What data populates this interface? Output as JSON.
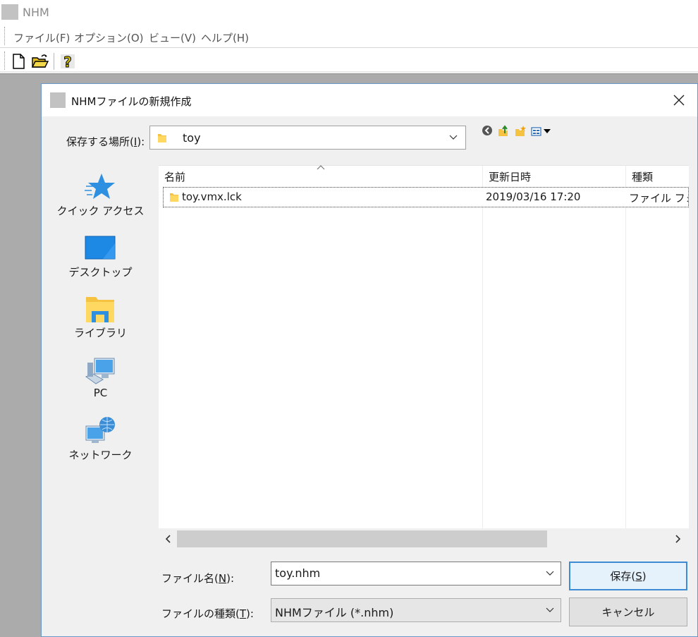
{
  "app": {
    "title": "NHM"
  },
  "menu": [
    "ファイル(F)",
    "オプション(O)",
    "ビュー(V)",
    "ヘルプ(H)"
  ],
  "toolbar": [
    "new-file-icon",
    "open-folder-icon",
    "help-icon"
  ],
  "dialog": {
    "title": "NHMファイルの新規作成",
    "location_label": "保存する場所",
    "location_hotkey": "I",
    "location_value": "toy",
    "places": [
      {
        "label": "クイック アクセス",
        "icon": "quick-access-star-icon"
      },
      {
        "label": "デスクトップ",
        "icon": "desktop-icon"
      },
      {
        "label": "ライブラリ",
        "icon": "library-icon"
      },
      {
        "label": "PC",
        "icon": "pc-icon"
      },
      {
        "label": "ネットワーク",
        "icon": "network-icon"
      }
    ],
    "columns": [
      "名前",
      "更新日時",
      "種類"
    ],
    "rows": [
      {
        "name": "toy.vmx.lck",
        "modified": "2019/03/16 17:20",
        "type": "ファイル フォルダー"
      }
    ],
    "filename_label": "ファイル名",
    "filename_hotkey": "N",
    "filename_value": "toy.nhm",
    "filetype_label": "ファイルの種類",
    "filetype_hotkey": "T",
    "filetype_value": "NHMファイル (*.nhm)",
    "save_label": "保存",
    "save_hotkey": "S",
    "cancel_label": "キャンセル"
  },
  "colors": {
    "accent": "#3c8bd3",
    "workspace": "#ababab",
    "folder": "#f5c242"
  }
}
